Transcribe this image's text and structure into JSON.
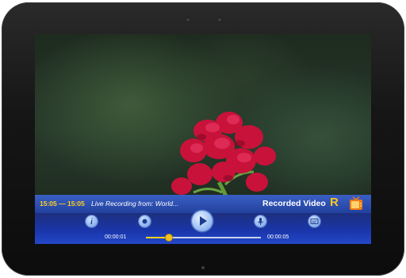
{
  "top_bar": {
    "time_range": "15:05 — 15:05",
    "recording_text": "Live Recording from: World...",
    "mode_label": "Recorded Video",
    "mode_badge": "R",
    "tv_icon": "tv-icon"
  },
  "controls": {
    "buttons": [
      {
        "name": "info-button",
        "icon": "info-icon"
      },
      {
        "name": "record-button",
        "icon": "record-dot-icon"
      },
      {
        "name": "play-button",
        "icon": "play-icon"
      },
      {
        "name": "microphone-button",
        "icon": "microphone-icon"
      },
      {
        "name": "subtitles-button",
        "icon": "subtitles-icon"
      }
    ],
    "current_time": "00:00:01",
    "total_time": "00:00:05",
    "progress": 0.2
  },
  "colors": {
    "accent_yellow": "#ffd21f",
    "bar_blue": "#23419e"
  }
}
